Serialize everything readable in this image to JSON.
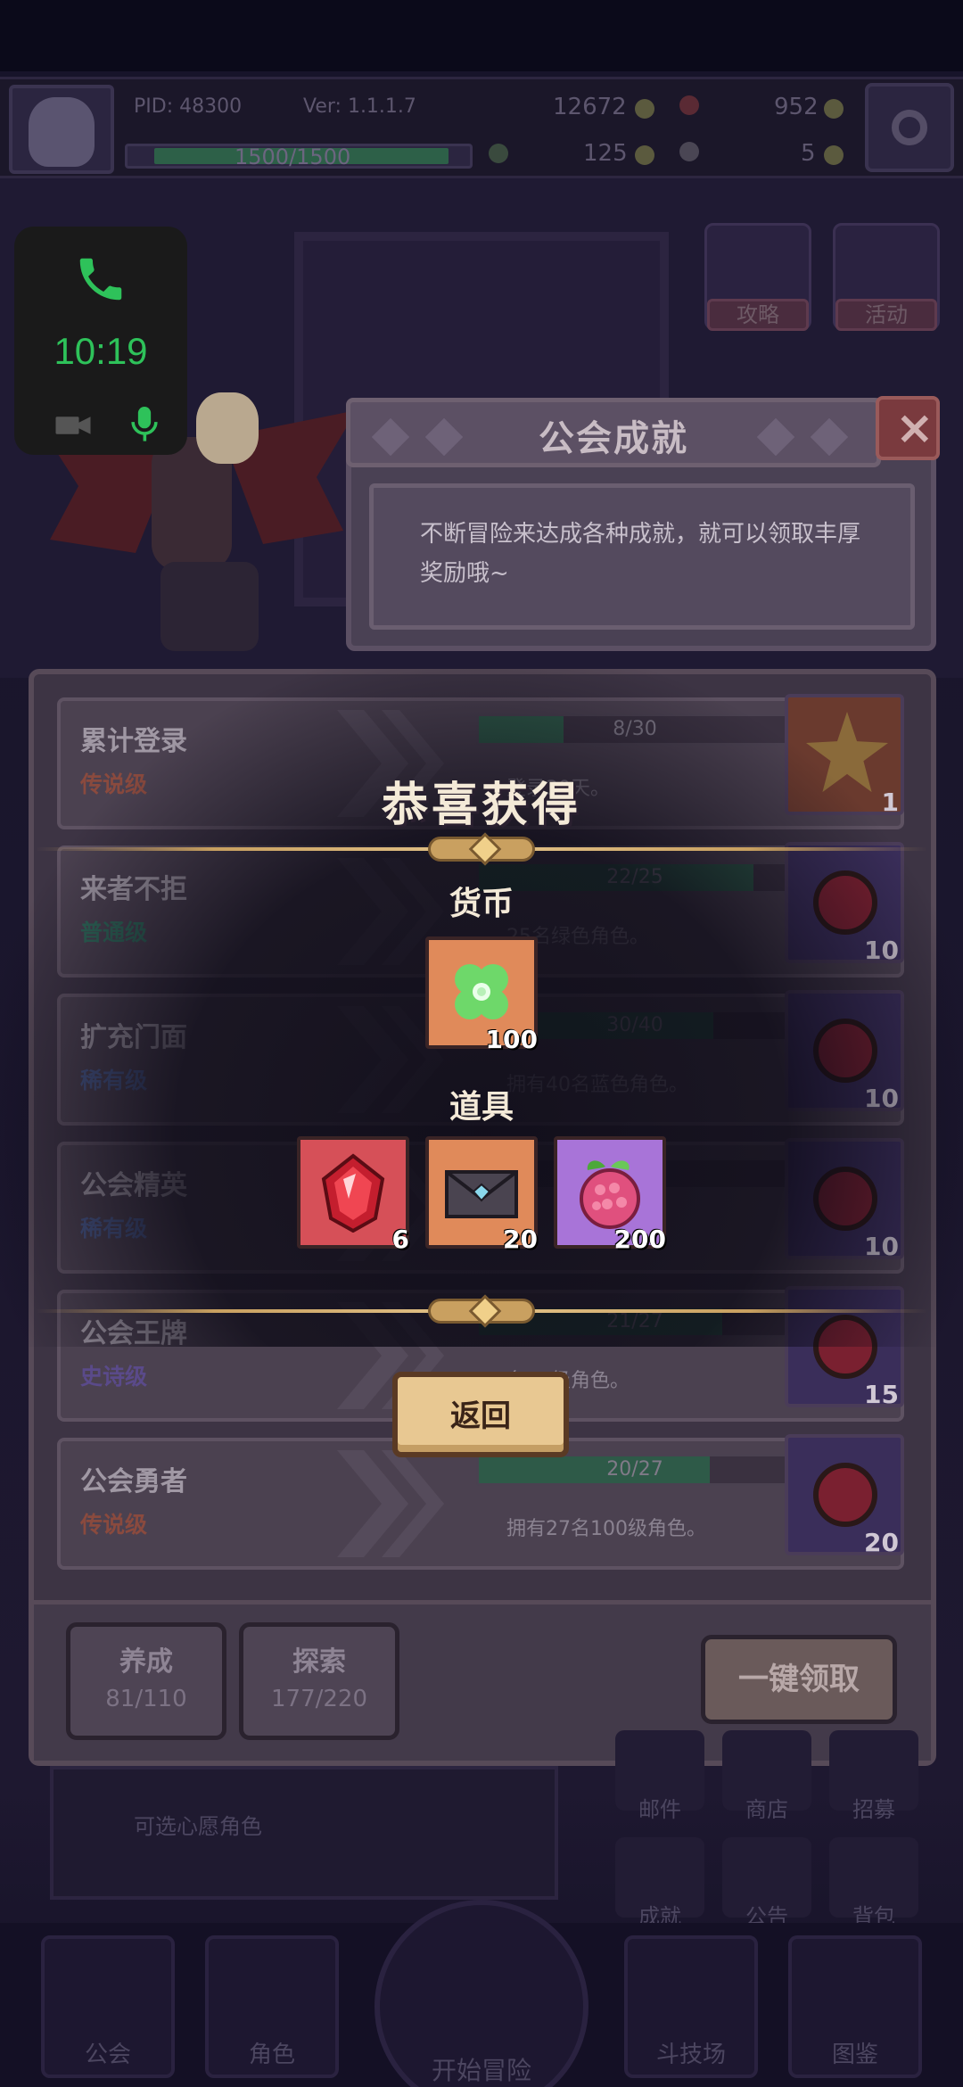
{
  "hud": {
    "pid": "PID: 48300",
    "version": "Ver: 1.1.1.7",
    "hp": "1500/1500",
    "hp_fraction": 1.0,
    "gold": "12672",
    "gems": "952",
    "clover": "125",
    "keys": "5"
  },
  "scene": {
    "btn_guide": "攻略",
    "btn_event": "活动"
  },
  "call_overlay": {
    "time": "10:19"
  },
  "guild": {
    "title": "公会成就",
    "description": "不断冒险来达成各种成就，就可以领取丰厚奖励哦~"
  },
  "achievements": [
    {
      "name": "累计登录",
      "grade": "传说级",
      "grade_color": "#8a4a3e",
      "progress": "8/30",
      "fraction": 0.27,
      "condition": "登录30天。",
      "reward": "star",
      "count": "1"
    },
    {
      "name": "来者不拒",
      "grade": "普通级",
      "grade_color": "#2f6a5a",
      "progress": "22/25",
      "fraction": 0.88,
      "condition": "25名绿色角色。",
      "reward": "gem",
      "count": "10"
    },
    {
      "name": "扩充门面",
      "grade": "稀有级",
      "grade_color": "#4a5a8a",
      "progress": "30/40",
      "fraction": 0.75,
      "condition": "拥有40名蓝色角色。",
      "reward": "gem",
      "count": "10"
    },
    {
      "name": "公会精英",
      "grade": "稀有级",
      "grade_color": "#4a5a8a",
      "progress": "",
      "fraction": 0.0,
      "condition": "",
      "reward": "gem",
      "count": "10"
    },
    {
      "name": "公会王牌",
      "grade": "史诗级",
      "grade_color": "#5a4a8a",
      "progress": "21/27",
      "fraction": 0.78,
      "condition": "名50级角色。",
      "reward": "gem",
      "count": "15"
    },
    {
      "name": "公会勇者",
      "grade": "传说级",
      "grade_color": "#8a4a3e",
      "progress": "20/27",
      "fraction": 0.74,
      "condition": "拥有27名100级角色。",
      "reward": "gem",
      "count": "20"
    }
  ],
  "footer": {
    "tab1_label": "养成",
    "tab1_value": "81/110",
    "tab2_label": "探索",
    "tab2_value": "177/220",
    "claim_all": "一键领取"
  },
  "background_ui": {
    "card_text": "可选心愿角色",
    "side_mail": "邮件",
    "side_shop": "商店",
    "side_recruit": "招募",
    "side_achieve": "成就",
    "side_notice": "公告",
    "side_bag": "背包",
    "nav_guild": "公会",
    "nav_role": "角色",
    "nav_start": "开始冒险",
    "nav_arena": "斗技场",
    "nav_book": "图鉴"
  },
  "reward": {
    "title": "恭喜获得",
    "currency_header": "货币",
    "items_header": "道具",
    "currency": [
      {
        "icon": "clover-icon",
        "qty": "100",
        "bg": "#e08a5a"
      }
    ],
    "items": [
      {
        "icon": "red-gem-icon",
        "qty": "6",
        "bg": "#d65058"
      },
      {
        "icon": "letter-icon",
        "qty": "20",
        "bg": "#e08a5a"
      },
      {
        "icon": "raspberry-icon",
        "qty": "200",
        "bg": "#a874d8"
      }
    ],
    "back_button": "返回"
  }
}
